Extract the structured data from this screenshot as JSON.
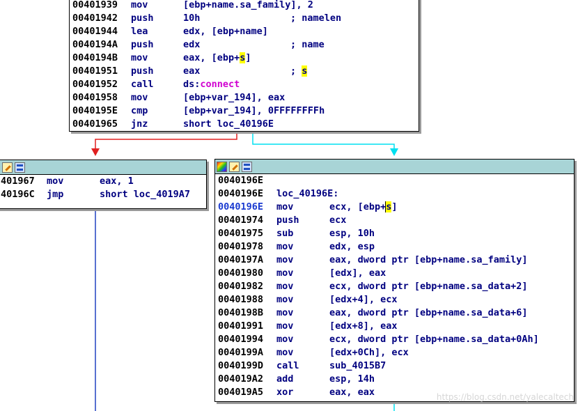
{
  "top_block": {
    "lines": [
      {
        "addr": "00401939",
        "mn": "mov",
        "ops": "[ebp+name.sa_family], 2",
        "cm": ""
      },
      {
        "addr": "00401942",
        "mn": "push",
        "ops": "10h",
        "cm": "; namelen"
      },
      {
        "addr": "00401944",
        "mn": "lea",
        "ops": "edx, [ebp+name]",
        "cm": ""
      },
      {
        "addr": "0040194A",
        "mn": "push",
        "ops": "edx",
        "cm": "; name"
      },
      {
        "addr": "0040194B",
        "mn": "mov",
        "ops_pre": "eax, [ebp+",
        "ops_hl": "s",
        "ops_post": "]"
      },
      {
        "addr": "00401951",
        "mn": "push",
        "ops": "eax",
        "cm_pre": "; ",
        "cm_hl": "s"
      },
      {
        "addr": "00401952",
        "mn": "call",
        "ops_pre": "ds:",
        "ops_imp": "connect"
      },
      {
        "addr": "00401958",
        "mn": "mov",
        "ops": "[ebp+var_194], eax",
        "cm": ""
      },
      {
        "addr": "0040195E",
        "mn": "cmp",
        "ops": "[ebp+var_194], 0FFFFFFFFh",
        "cm": ""
      },
      {
        "addr": "00401965",
        "mn": "jnz",
        "ops": "short loc_40196E",
        "cm": ""
      }
    ]
  },
  "left_block": {
    "lines": [
      {
        "addr": "401967",
        "mn": "mov",
        "ops": "eax, 1"
      },
      {
        "addr": "40196C",
        "mn": "jmp",
        "ops": "short loc_4019A7"
      }
    ]
  },
  "right_block": {
    "header_addr": "0040196E",
    "label_line": {
      "addr": "0040196E",
      "label": "loc_40196E:"
    },
    "sel_line": {
      "addr": "0040196E",
      "mn": "mov",
      "ops_pre": "ecx, [ebp+",
      "ops_hl": "s",
      "ops_post": "]"
    },
    "lines": [
      {
        "addr": "00401974",
        "mn": "push",
        "ops": "ecx"
      },
      {
        "addr": "00401975",
        "mn": "sub",
        "ops": "esp, 10h"
      },
      {
        "addr": "00401978",
        "mn": "mov",
        "ops": "edx, esp"
      },
      {
        "addr": "0040197A",
        "mn": "mov",
        "ops": "eax, dword ptr [ebp+name.sa_family]"
      },
      {
        "addr": "00401980",
        "mn": "mov",
        "ops": "[edx], eax"
      },
      {
        "addr": "00401982",
        "mn": "mov",
        "ops": "ecx, dword ptr [ebp+name.sa_data+2]"
      },
      {
        "addr": "00401988",
        "mn": "mov",
        "ops": "[edx+4], ecx"
      },
      {
        "addr": "0040198B",
        "mn": "mov",
        "ops": "eax, dword ptr [ebp+name.sa_data+6]"
      },
      {
        "addr": "00401991",
        "mn": "mov",
        "ops": "[edx+8], eax"
      },
      {
        "addr": "00401994",
        "mn": "mov",
        "ops": "ecx, dword ptr [ebp+name.sa_data+0Ah]"
      },
      {
        "addr": "0040199A",
        "mn": "mov",
        "ops": "[edx+0Ch], ecx"
      },
      {
        "addr": "0040199D",
        "mn": "call",
        "ops": "sub_4015B7"
      },
      {
        "addr": "004019A2",
        "mn": "add",
        "ops": "esp, 14h"
      },
      {
        "addr": "004019A5",
        "mn": "xor",
        "ops": "eax, eax"
      }
    ]
  },
  "icons": {
    "color": "color-palette-icon",
    "edit": "edit-icon",
    "graph": "graph-view-icon"
  },
  "colors": {
    "header_bg": "#a8d4d6",
    "address_fg": "#000000",
    "selected_address_fg": "#1a3ad0",
    "operand_fg": "#000080",
    "import_fg": "#d000d0",
    "highlight_bg": "#ffff00",
    "false_edge": "#e02020",
    "true_edge": "#00e0f0",
    "unconditional_edge": "#2040c0"
  },
  "watermark": "https://blog.csdn.net/yalecaltech"
}
